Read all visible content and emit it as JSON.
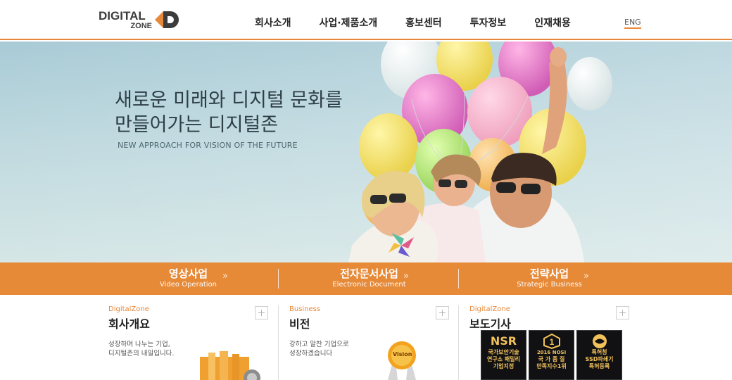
{
  "header": {
    "logo": {
      "line1": "DIGITAL",
      "line2": "ZONE",
      "mark_letter": "D"
    },
    "nav": [
      "회사소개",
      "사업·제품소개",
      "홍보센터",
      "투자정보",
      "인재채용"
    ],
    "lang": "ENG"
  },
  "hero": {
    "title_line1": "새로운 미래와 디지털 문화를",
    "title_line2": "만들어가는 디지털존",
    "subtitle": "NEW APPROACH FOR VISION OF THE  FUTURE"
  },
  "services": [
    {
      "name": "영상사업",
      "en": "Video Operation",
      "arrow": "»"
    },
    {
      "name": "전자문서사업",
      "en": "Electronic Document",
      "arrow": "»"
    },
    {
      "name": "전략사업",
      "en": "Strategic Business",
      "arrow": "»"
    }
  ],
  "columns": [
    {
      "kicker": "DigitalZone",
      "title": "회사개요",
      "desc": "성장하며 나누는 기업,\n디지털존의 내일입니다."
    },
    {
      "kicker": "Business",
      "title": "비전",
      "desc": "강하고 알찬 기업으로\n성장하겠습니다",
      "badge": "Vision"
    },
    {
      "kicker": "DigitalZone",
      "title": "보도기사"
    }
  ],
  "awards": [
    {
      "icon_text": "NSR",
      "line1": "국가보안기술",
      "line2": "연구소 패밀리",
      "line3": "기업지정"
    },
    {
      "icon_text": "2016 NOSI",
      "line1": "국 가 품 질",
      "line2": "만족지수1위"
    },
    {
      "icon_text": "특허청",
      "line1": "SSD파쇄기",
      "line2": "특허등록"
    }
  ],
  "colors": {
    "accent": "#e78a38",
    "text_dark": "#222222"
  }
}
